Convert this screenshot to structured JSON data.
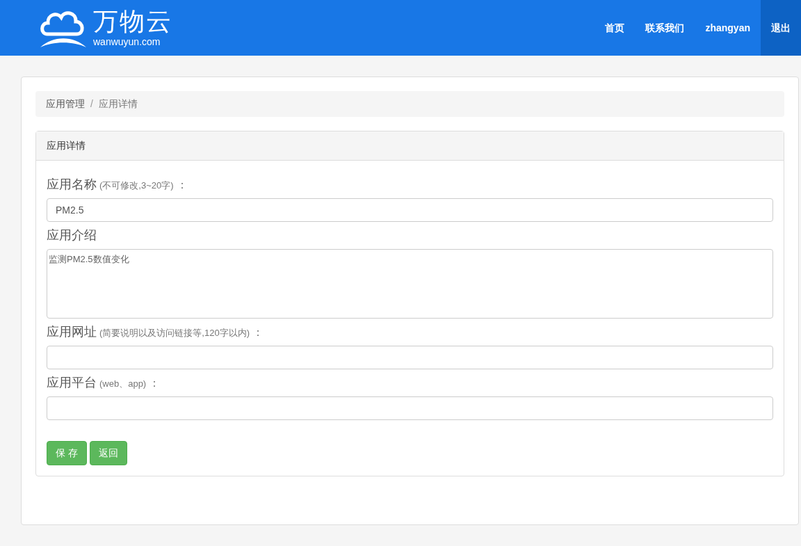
{
  "logo": {
    "name": "万物云",
    "domain": "wanwuyun.com"
  },
  "nav": [
    {
      "label": "首页",
      "selected": false
    },
    {
      "label": "联系我们",
      "selected": false
    },
    {
      "label": "zhangyan",
      "selected": false
    },
    {
      "label": "退出",
      "selected": true
    }
  ],
  "breadcrumb": {
    "separator": "/",
    "items": [
      "应用管理",
      "应用详情"
    ]
  },
  "panel": {
    "title": "应用详情",
    "fields": [
      {
        "kind": "input",
        "label": "应用名称",
        "hint": "(不可修改,3~20字)",
        "suffix": "：",
        "value": "PM2.5"
      },
      {
        "kind": "textarea",
        "label": "应用介绍",
        "value": "监测PM2.5数值变化"
      },
      {
        "kind": "input",
        "label": "应用网址",
        "hint": "(简要说明以及访问链接等,120字以内)",
        "suffix": "："
      },
      {
        "kind": "input",
        "label": "应用平台",
        "hint": "(web、app)",
        "suffix": "："
      }
    ],
    "buttons": [
      "保 存",
      "返回"
    ]
  }
}
